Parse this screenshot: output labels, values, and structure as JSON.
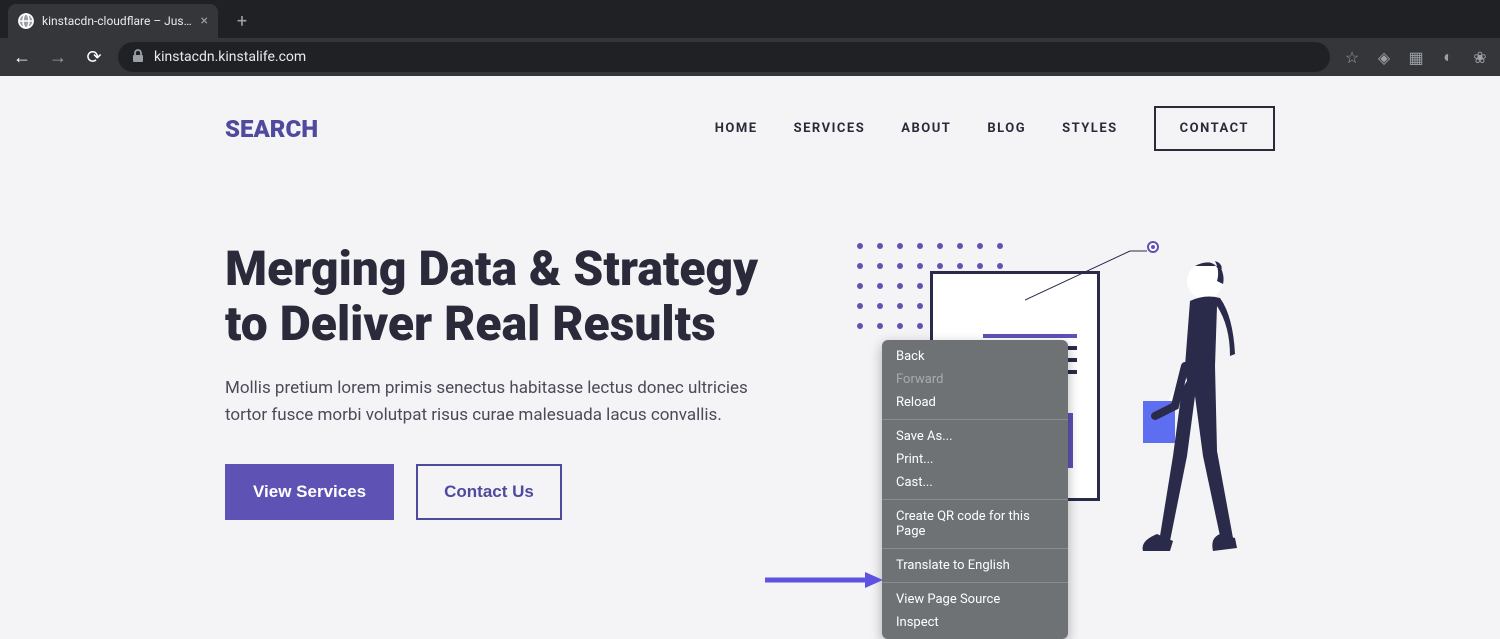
{
  "browser": {
    "tab_title": "kinstacdn-cloudflare – Just an...",
    "url": "kinstacdn.kinstalife.com"
  },
  "site": {
    "logo": "SEARCH",
    "nav": {
      "home": "HOME",
      "services": "SERVICES",
      "about": "ABOUT",
      "blog": "BLOG",
      "styles": "STYLES",
      "contact": "CONTACT"
    },
    "hero": {
      "title": "Merging Data & Strategy to Deliver Real Results",
      "desc": "Mollis pretium lorem primis senectus habitasse lectus donec ultricies tortor fusce morbi volutpat risus curae malesuada lacus convallis.",
      "btn_primary": "View Services",
      "btn_secondary": "Contact Us"
    }
  },
  "context_menu": {
    "back": "Back",
    "forward": "Forward",
    "reload": "Reload",
    "save_as": "Save As...",
    "print": "Print...",
    "cast": "Cast...",
    "qr": "Create QR code for this Page",
    "translate": "Translate to English",
    "view_source": "View Page Source",
    "inspect": "Inspect"
  }
}
